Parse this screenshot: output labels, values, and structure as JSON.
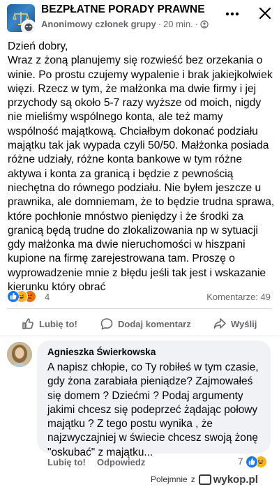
{
  "header": {
    "group_name": "BEZPŁATNE PORADY PRAWNE",
    "author": "Anonimowy członek grupy",
    "separator": "·",
    "time": "20 min.",
    "separator2": "·"
  },
  "post": {
    "text": "Dzień dobry,\nWraz z żoną planujemy się rozwieść bez orzekania o winie. Po prostu czujemy wypalenie i brak jakiejkolwiek więzi. Rzecz w tym, że małżonka ma dwie firmy i jej przychody są około 5-7 razy wyższe od moich, nigdy nie mieliśmy wspólnego konta, ale też mamy wspólność majątkową. Chciałbym dokonać podziału majątku tak jak wypada czyli 50/50. Małżonka posiada różne udziały, różne konta bankowe w tym różne aktywa i konta za granicą i będzie z pewnością niechętna do równego podziału. Nie byłem jeszcze u prawnika, ale domniemam, że to będzie trudna sprawa, które pochłonie mnóstwo pieniędzy i że środki za granicą będą trudne do zlokalizowania np w sytuacji gdy małżonka ma dwie nieruchomości w hiszpani kupione na firmę zarejestrowana tam. Proszę o wyprowadzenie mnie z błędu jeśli tak jest i wskazanie kierunku który obrać",
    "reaction_count": "4",
    "comments_label": "Komentarze: 49"
  },
  "actions": {
    "like": "Lubię to!",
    "comment": "Dodaj komentarz",
    "share": "Wyślij"
  },
  "comment": {
    "author": "Agnieszka Świerkowska",
    "text": "A napisz chłopie, co Ty robiłeś w tym czasie, gdy żona zarabiała pieniądze? Zajmowałeś się domem ? Dziećmi ? Podaj argumenty jakimi chcesz się podeprzeć żądając połowy majątku ? Z tego postu wynika , że najzwyczajniej w świecie chcesz swoją żonę \"oskubać\" z majątku...",
    "like": "Lubię to!",
    "reply": "Odpowiedz",
    "reaction_count": "7"
  },
  "watermark": {
    "user": "Polejmnie",
    "prefix": "z",
    "site": "wykop.pl"
  },
  "colors": {
    "like_blue": "#1877f2",
    "love_red": "#f02849",
    "haha_yellow": "#f7b125",
    "angry_orange": "#e9710f",
    "muted_text": "#65676b",
    "bubble_bg": "#f0f2f5"
  }
}
